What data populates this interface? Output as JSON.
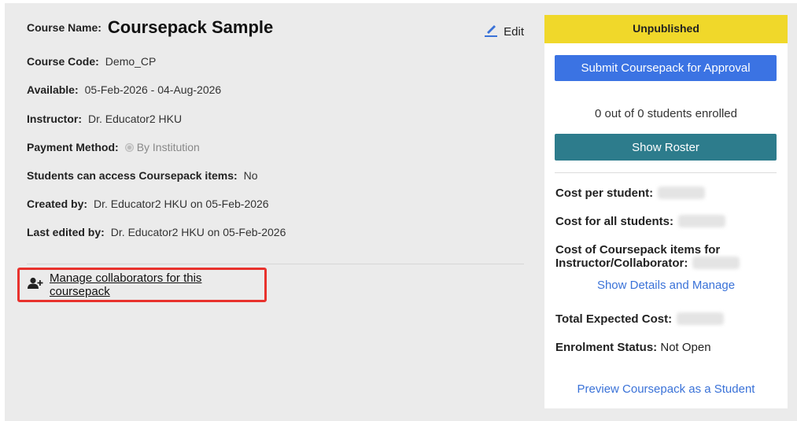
{
  "course": {
    "name_label": "Course Name:",
    "name": "Coursepack Sample",
    "edit_label": "Edit",
    "code_label": "Course Code:",
    "code": "Demo_CP",
    "available_label": "Available:",
    "available": "05-Feb-2026 - 04-Aug-2026",
    "instructor_label": "Instructor:",
    "instructor": "Dr. Educator2 HKU",
    "payment_label": "Payment Method:",
    "payment": "By Institution",
    "access_label": "Students can access Coursepack items:",
    "access": "No",
    "created_label": "Created by:",
    "created": "Dr. Educator2 HKU on 05-Feb-2026",
    "edited_label": "Last edited by:",
    "edited": "Dr. Educator2 HKU on 05-Feb-2026",
    "collaborators_link": "Manage collaborators for this coursepack"
  },
  "sidebar": {
    "status": "Unpublished",
    "submit_button": "Submit Coursepack for Approval",
    "enrolled_text": "0 out of 0 students enrolled",
    "roster_button": "Show Roster",
    "cost_per_student_label": "Cost per student:",
    "cost_all_label": "Cost for all students:",
    "cost_items_label_1": "Cost of Coursepack items for",
    "cost_items_label_2": "Instructor/Collaborator:",
    "details_link": "Show Details and Manage",
    "total_label": "Total Expected Cost:",
    "enrolment_label": "Enrolment Status:",
    "enrolment_value": "Not Open",
    "preview_link": "Preview Coursepack as a Student"
  },
  "colors": {
    "status_bar": "#f0d82a",
    "submit_button": "#3b73e3",
    "roster_button": "#2d7c8c",
    "link": "#3a72d8",
    "highlight_border": "#e8322d"
  },
  "icons": {
    "edit": "pencil-icon",
    "collaborators": "add-user-icon"
  }
}
